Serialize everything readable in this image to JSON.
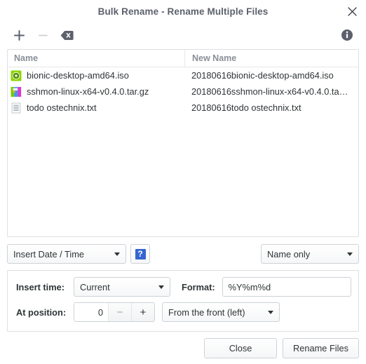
{
  "window": {
    "title": "Bulk Rename - Rename Multiple Files",
    "close_label": "close-icon"
  },
  "toolbar": {
    "add_label": "+",
    "remove_label": "−",
    "clear_label": "clear-icon",
    "info_label": "info-icon"
  },
  "file_list": {
    "columns": [
      "Name",
      "New Name"
    ],
    "rows": [
      {
        "icon": "iso-disc-icon",
        "name": "bionic-desktop-amd64.iso",
        "new_name": "20180616bionic-desktop-amd64.iso"
      },
      {
        "icon": "archive-icon",
        "name": "sshmon-linux-x64-v0.4.0.tar.gz",
        "new_name": "20180616sshmon-linux-x64-v0.4.0.ta…"
      },
      {
        "icon": "text-file-icon",
        "name": "todo ostechnix.txt",
        "new_name": "20180616todo ostechnix.txt"
      }
    ]
  },
  "options": {
    "action": "Insert Date / Time",
    "help": "?",
    "scope": "Name only"
  },
  "settings": {
    "insert_time_label": "Insert time:",
    "insert_time_value": "Current",
    "format_label": "Format:",
    "format_value": "%Y%m%d",
    "at_position_label": "At position:",
    "at_position_value": "0",
    "spin_minus": "−",
    "spin_plus": "+",
    "direction_value": "From the front (left)"
  },
  "buttons": {
    "close": "Close",
    "rename": "Rename Files"
  },
  "colors": {
    "title_text": "#5c616c",
    "accent_blue": "#3465d1",
    "border": "#cdd2d7",
    "text": "#2e3436"
  }
}
